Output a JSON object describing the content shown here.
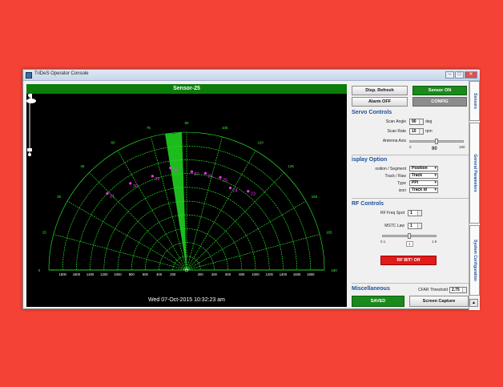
{
  "window": {
    "title": "TriDeS Operator Console"
  },
  "radar": {
    "sensor_name": "Sensor-25",
    "timestamp": "Wed 07-Oct-2015 10:32:23 am",
    "angle_labels": [
      "0",
      "15",
      "30",
      "45",
      "60",
      "75",
      "90",
      "105",
      "120",
      "135",
      "150",
      "165",
      "180"
    ],
    "range_labels_left": [
      "1800",
      "1600",
      "1400",
      "1200",
      "1000",
      "800",
      "600",
      "400",
      "200"
    ],
    "range_labels_right": [
      "200",
      "400",
      "600",
      "800",
      "1000",
      "1200",
      "1400",
      "1600",
      "1800"
    ],
    "sweep_angle": 90,
    "targets": [
      {
        "id": "23",
        "angle": 128,
        "range": 1450
      },
      {
        "id": "24",
        "angle": 118,
        "range": 1350
      },
      {
        "id": "25",
        "angle": 110,
        "range": 1430
      },
      {
        "id": "26",
        "angle": 101,
        "range": 1430
      },
      {
        "id": "27",
        "angle": 93,
        "range": 1430
      },
      {
        "id": "28",
        "angle": 81,
        "range": 1500
      },
      {
        "id": "29",
        "angle": 70,
        "range": 1450
      },
      {
        "id": "30",
        "angle": 57,
        "range": 1500
      },
      {
        "id": "31",
        "angle": 44,
        "range": 1600
      }
    ],
    "colors": {
      "grid": "#2aff2a",
      "target": "#ff33ff",
      "sweep": "#22dd22"
    }
  },
  "panel": {
    "disp_refresh": "Disp. Refresh",
    "sensor_on": "Sensor ON",
    "alarm_off": "Alarm OFF",
    "config": "CONFIG",
    "servo": {
      "title": "Servo Controls",
      "scan_angle_label": "Scan Angle",
      "scan_angle_value": "90",
      "scan_angle_unit": "deg",
      "scan_rate_label": "Scan Rate",
      "scan_rate_value": "10",
      "scan_rate_unit": "rpm",
      "antenna_label": "Antenna Axis",
      "antenna_min": "0",
      "antenna_max": "180",
      "antenna_value": "90"
    },
    "display": {
      "title": "isplay Option",
      "rows": [
        {
          "label": "osition / Segment",
          "value": "Position"
        },
        {
          "label": "Track / Raw",
          "value": "Track"
        },
        {
          "label": "Type",
          "value": "PPI"
        },
        {
          "label": "izon",
          "value": "Track id"
        }
      ]
    },
    "rf": {
      "title": "RF Controls",
      "freq_label": "RF Freq Spot",
      "freq_value": "1",
      "mstc_label": "MSTC Law",
      "mstc_value": "1",
      "slider_min": "0.1",
      "slider_max": "1.9",
      "slider_value": "1",
      "rf_btn": "RF BIT! Off"
    },
    "misc": {
      "title": "Miscellaneous",
      "cfar_label": "CFAR Threshold",
      "cfar_value": "2.75",
      "saved": "SAVED",
      "screen_capture": "Screen Capture"
    }
  },
  "tabs": [
    "Sensors",
    "General Parameters",
    "System Configuration"
  ]
}
